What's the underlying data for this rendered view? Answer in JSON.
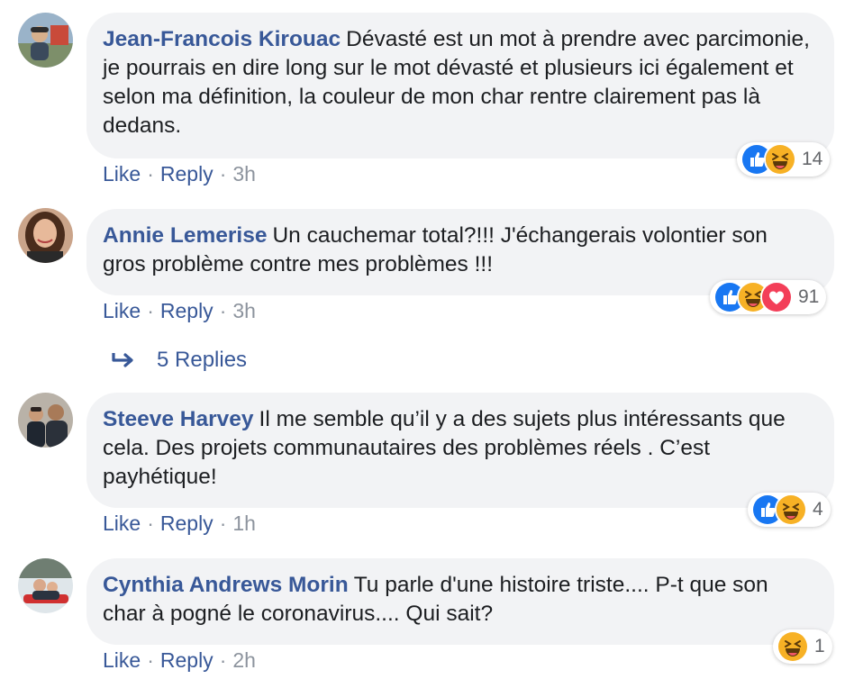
{
  "comments": [
    {
      "author": "Jean-Francois Kirouac",
      "text": "Dévasté est un mot à prendre avec parcimonie, je pourrais en dire long sur le mot dévasté et plusieurs ici également et selon ma définition, la couleur de mon char rentre clairement pas là dedans.",
      "like_label": "Like",
      "reply_label": "Reply",
      "time": "3h",
      "reaction_icons": [
        "like-icon",
        "haha-icon"
      ],
      "reaction_count": "14"
    },
    {
      "author": "Annie Lemerise",
      "text": "Un cauchemar total?!!! J'échangerais volontier son gros problème contre mes problèmes !!!",
      "like_label": "Like",
      "reply_label": "Reply",
      "time": "3h",
      "reaction_icons": [
        "like-icon",
        "haha-icon",
        "love-icon"
      ],
      "reaction_count": "91"
    },
    {
      "author": "Steeve Harvey",
      "text": "Il me semble qu’il y a des sujets plus intéressants que cela. Des projets communautaires des problèmes réels . C’est payhétique!",
      "like_label": "Like",
      "reply_label": "Reply",
      "time": "1h",
      "reaction_icons": [
        "like-icon",
        "haha-icon"
      ],
      "reaction_count": "4"
    },
    {
      "author": "Cynthia Andrews Morin",
      "text": "Tu parle d'une histoire triste.... P-t que son char à pogné le coronavirus.... Qui sait?",
      "like_label": "Like",
      "reply_label": "Reply",
      "time": "2h",
      "reaction_icons": [
        "haha-icon"
      ],
      "reaction_count": "1"
    }
  ],
  "replies_toggle": {
    "label": "5 Replies"
  },
  "separator": "·",
  "colors": {
    "author": "#385898",
    "bubble": "#f2f3f5",
    "meta": "#8d949e",
    "like_blue": "#1877f2",
    "haha_yellow": "#f7b125",
    "love_red": "#f33e58"
  }
}
